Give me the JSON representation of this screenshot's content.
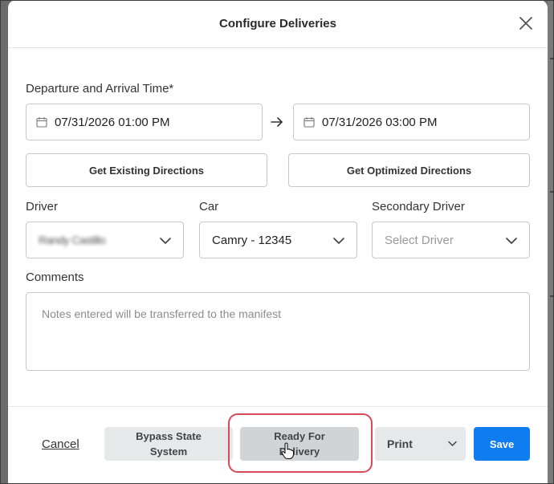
{
  "modal": {
    "title": "Configure Deliveries"
  },
  "schedule": {
    "label": "Departure and Arrival Time*",
    "departure_value": "07/31/2026 01:00 PM",
    "arrival_value": "07/31/2026 03:00 PM"
  },
  "directions": {
    "existing_label": "Get Existing Directions",
    "optimized_label": "Get Optimized Directions"
  },
  "driver": {
    "label": "Driver",
    "value": "Randy Castillo"
  },
  "car": {
    "label": "Car",
    "value": "Camry - 12345"
  },
  "secondary_driver": {
    "label": "Secondary Driver",
    "placeholder": "Select Driver"
  },
  "comments": {
    "label": "Comments",
    "placeholder": "Notes entered will be transferred to the manifest"
  },
  "footer": {
    "cancel_label": "Cancel",
    "bypass_label_line1": "Bypass State",
    "bypass_label_line2": "System",
    "ready_label_line1": "Ready For",
    "ready_label_line2": "Delivery",
    "print_label": "Print",
    "save_label": "Save"
  },
  "colors": {
    "primary": "#0f7df0",
    "highlight": "#d9495a"
  },
  "icons": {
    "close": "close-icon",
    "calendar": "calendar-icon",
    "arrow": "arrow-right-icon",
    "chevron": "chevron-down-icon",
    "cursor": "hand-cursor-icon"
  }
}
